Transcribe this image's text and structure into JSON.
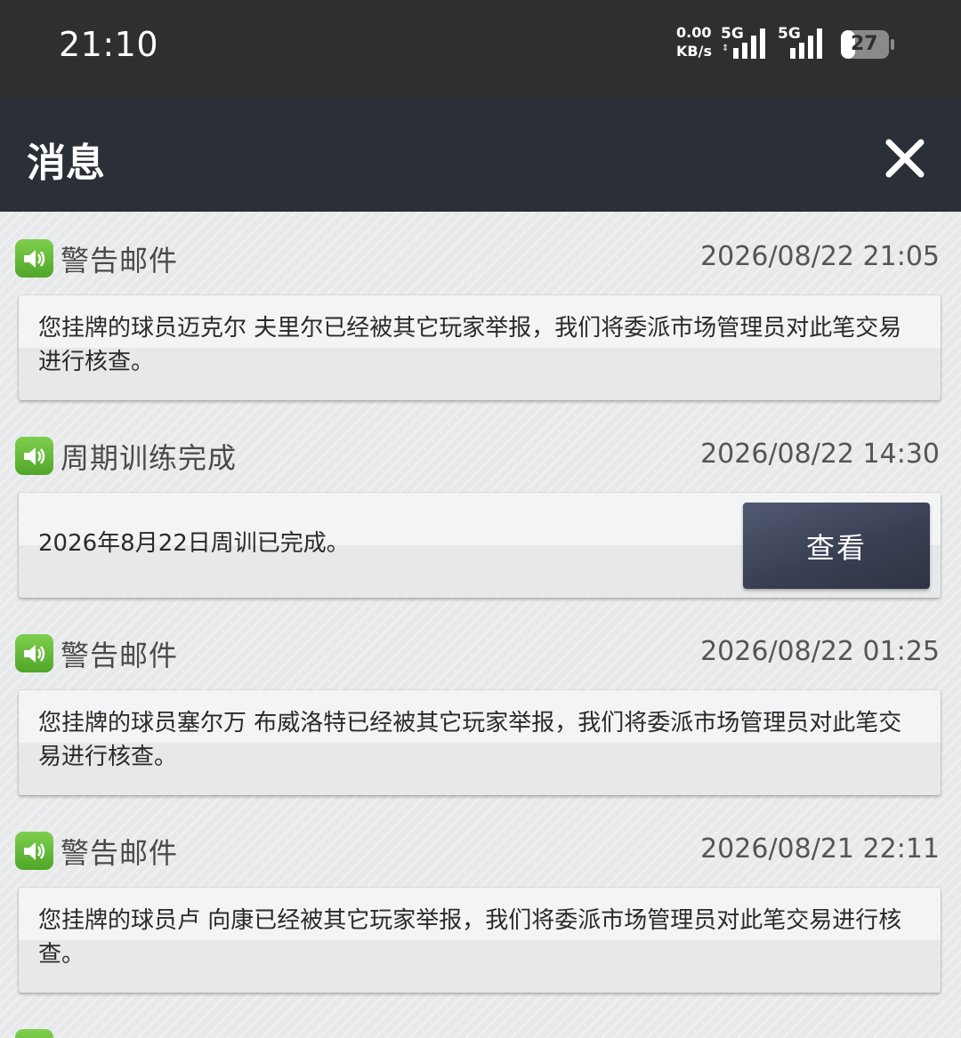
{
  "status_bar": {
    "time": "21:10",
    "net_speed_value": "0.00",
    "net_speed_unit": "KB/s",
    "sim1_label": "5G",
    "sim2_label": "5G",
    "battery_level": "27"
  },
  "header": {
    "title": "消息"
  },
  "messages": [
    {
      "title": "警告邮件",
      "time": "2026/08/22 21:05",
      "body": "您挂牌的球员迈克尔 夫里尔已经被其它玩家举报，我们将委派市场管理员对此笔交易进行核查。"
    },
    {
      "title": "周期训练完成",
      "time": "2026/08/22 14:30",
      "body": "2026年8月22日周训已完成。",
      "button_label": "查看"
    },
    {
      "title": "警告邮件",
      "time": "2026/08/22 01:25",
      "body": "您挂牌的球员塞尔万 布威洛特已经被其它玩家举报，我们将委派市场管理员对此笔交易进行核查。"
    },
    {
      "title": "警告邮件",
      "time": "2026/08/21 22:11",
      "body": "您挂牌的球员卢 向康已经被其它玩家举报，我们将委派市场管理员对此笔交易进行核查。"
    }
  ]
}
